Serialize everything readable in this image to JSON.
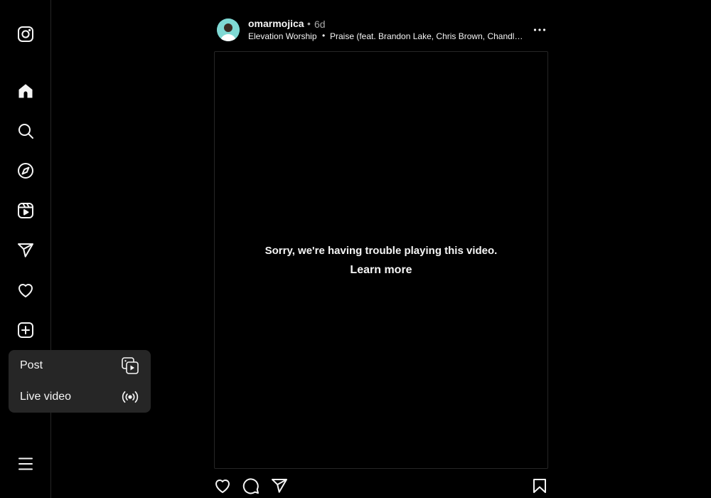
{
  "sidebar": {
    "icons": [
      "instagram-logo-icon",
      "home-icon",
      "search-icon",
      "compass-icon",
      "reels-icon",
      "paper-plane-icon",
      "heart-icon",
      "plus-square-icon",
      "hamburger-menu-icon"
    ]
  },
  "create_menu": {
    "items": [
      {
        "label": "Post",
        "icon": "post-media-icon"
      },
      {
        "label": "Live video",
        "icon": "live-broadcast-icon"
      }
    ]
  },
  "post": {
    "username": "omarmojica",
    "separator": "•",
    "time": "6d",
    "audio_artist": "Elevation Worship",
    "audio_separator": "•",
    "audio_track": "Praise (feat. Brandon Lake, Chris Brown, Chandler Moore)",
    "video_error": "Sorry, we're having trouble playing this video.",
    "learn_more": "Learn more"
  },
  "colors": {
    "background": "#000000",
    "menu_bg": "#262626",
    "text": "#f5f5f5",
    "secondary_text": "#a8a8a8",
    "border": "#262626"
  }
}
